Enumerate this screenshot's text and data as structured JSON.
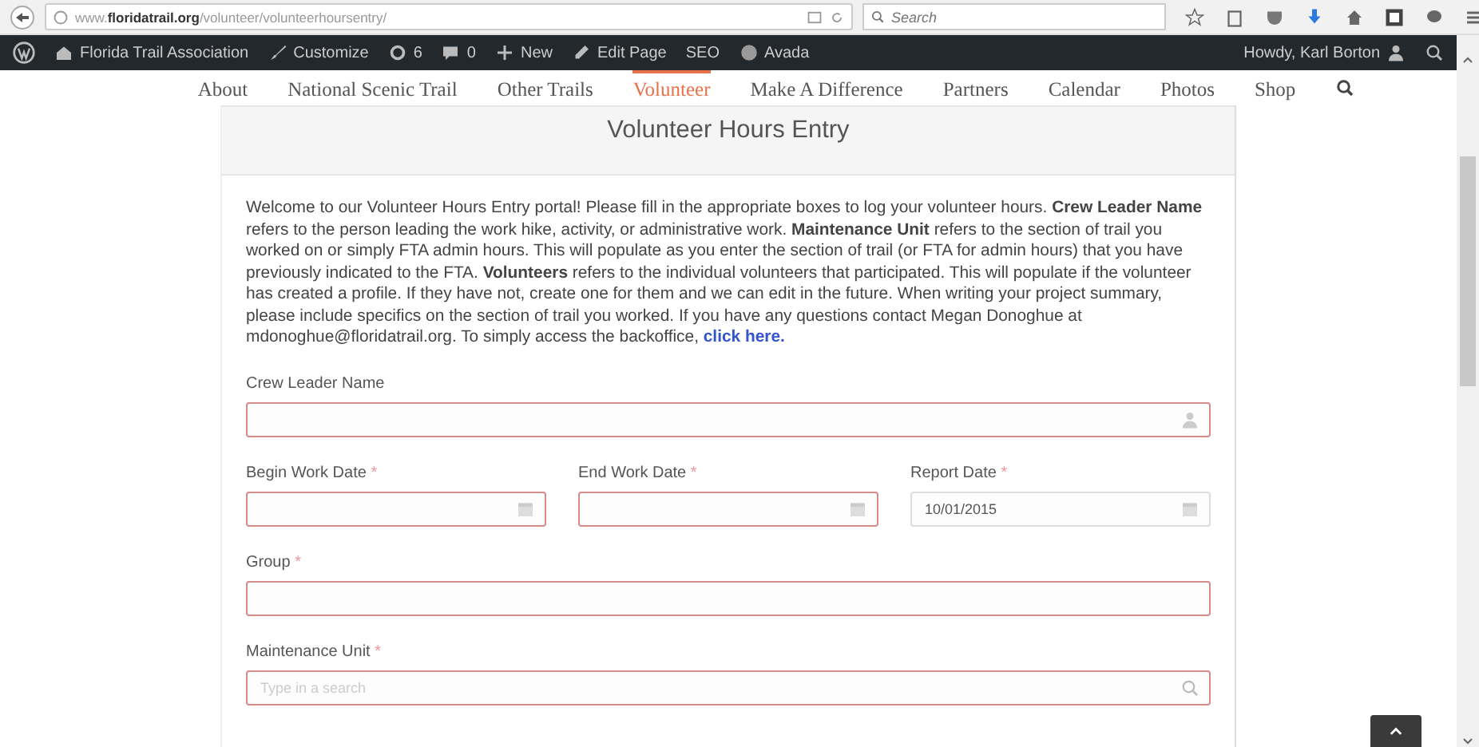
{
  "browser": {
    "url": "www.**floridatrail.org**/volunteer/volunteerhoursentry/",
    "search": {
      "placeholder": "Search"
    }
  },
  "admin_bar": {
    "items": [
      {
        "kind": "wordpress"
      },
      {
        "kind": "site",
        "label": "Florida Trail Association"
      },
      {
        "kind": "customize",
        "label": "Customize"
      },
      {
        "kind": "updates",
        "label": "6"
      },
      {
        "kind": "comments",
        "label": "0"
      },
      {
        "kind": "new",
        "label": "New"
      },
      {
        "kind": "edit",
        "label": "Edit Page"
      },
      {
        "kind": "text",
        "label": "SEO"
      },
      {
        "kind": "avada",
        "label": "Avada"
      }
    ],
    "greeting": "Howdy, Karl Borton"
  },
  "nav": [
    {
      "label": "About",
      "selected": false
    },
    {
      "label": "National Scenic Trail",
      "selected": false
    },
    {
      "label": "Other Trails",
      "selected": false
    },
    {
      "label": "Volunteer",
      "selected": true
    },
    {
      "label": "Make A Difference",
      "selected": false
    },
    {
      "label": "Partners",
      "selected": false
    },
    {
      "label": "Calendar",
      "selected": false
    },
    {
      "label": "Photos",
      "selected": false
    },
    {
      "label": "Shop",
      "selected": false
    }
  ],
  "form": {
    "title": "Volunteer Hours Entry",
    "intro": {
      "text": "Welcome to our Volunteer Hours Entry portal! Please fill in the appropriate boxes to log your volunteer hours.  **Crew Leader Name** refers to the person leading the work hike, activity, or administrative work. **Maintenance Unit** refers to the section of trail you worked on or simply FTA admin hours.  This will populate as you enter the section of trail (or FTA for admin hours) that you have previously indicated to the FTA. **Volunteers** refers to the individual volunteers that participated.  This will populate if the volunteer has created a profile.  If they have not, create one for them and we can edit in the future.  When writing your project summary, please include specifics on the section of trail you worked. If you have any questions contact Megan Donoghue at mdonoghue@floridatrail.org. To simply access the backoffice, ",
      "link": "click here."
    },
    "rows": [
      [
        {
          "kind": "person",
          "label": "Crew Leader Name",
          "invalid": true
        }
      ],
      [
        {
          "kind": "date",
          "label": "Begin Work Date",
          "required_mark": "*",
          "invalid": true
        },
        {
          "kind": "date",
          "label": "End Work Date",
          "required_mark": "*",
          "invalid": true
        },
        {
          "kind": "date",
          "label": "Report Date",
          "required_mark": "*",
          "invalid": false,
          "value": "10/01/2015"
        }
      ],
      [
        {
          "kind": "text",
          "label": "Group",
          "required_mark": "*",
          "invalid": true
        }
      ],
      [
        {
          "kind": "search",
          "label": "Maintenance Unit",
          "required_mark": "*",
          "invalid": true,
          "placeholder": "Type in a search"
        }
      ]
    ]
  }
}
